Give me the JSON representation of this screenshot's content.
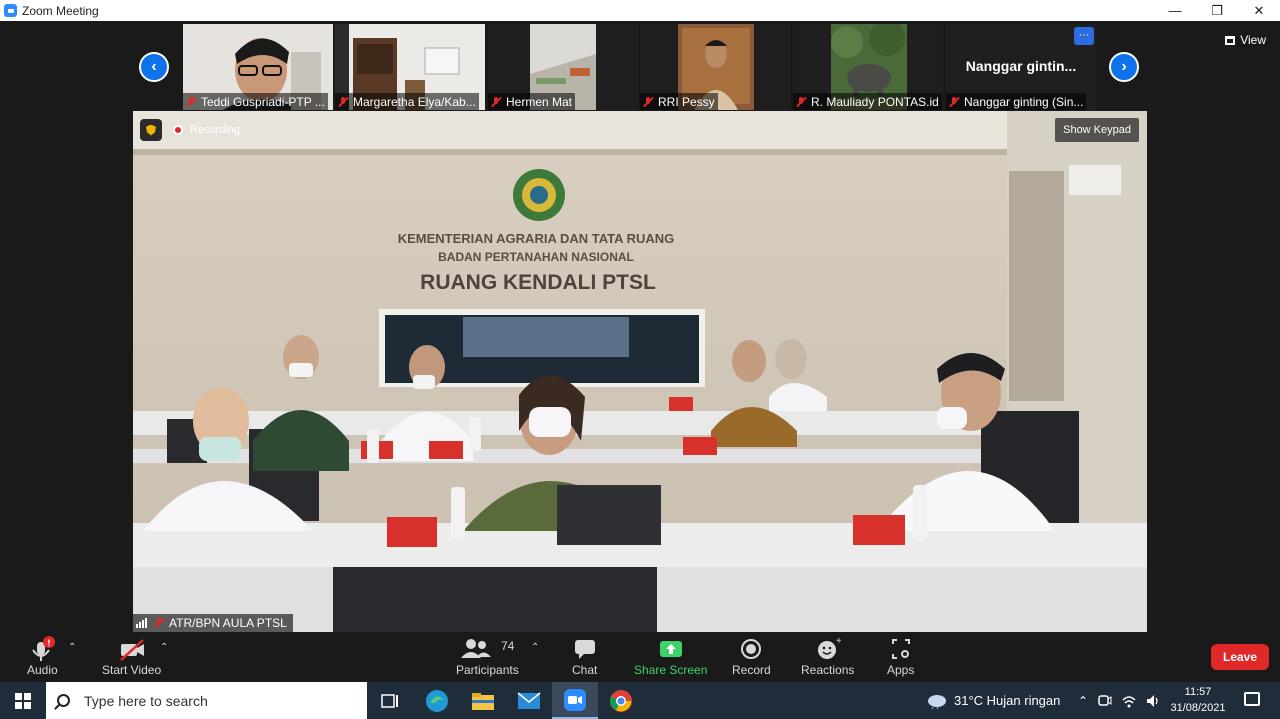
{
  "window": {
    "title": "Zoom Meeting",
    "minimize": "—",
    "restore": "❐",
    "close": "✕"
  },
  "gallery": {
    "prev_icon": "chevron-left-icon",
    "next_icon": "chevron-right-icon",
    "view_label": "View",
    "tiles": [
      {
        "name": "Teddi Guspriadi-PTP ...",
        "muted": true
      },
      {
        "name": "Margaretha Elya/Kab...",
        "muted": true
      },
      {
        "name": "Hermen Mat",
        "muted": true
      },
      {
        "name": "RRI Pessy",
        "muted": true
      },
      {
        "name": "R. Mauliady PONTAS.id",
        "muted": true
      },
      {
        "name": "Nanggar ginting (Sin...",
        "big_name": "Nanggar  gintin...",
        "more": "···",
        "muted": true
      }
    ]
  },
  "main_video": {
    "recording_label": "Recording",
    "show_keypad_label": "Show Keypad",
    "speaker_name": "ATR/BPN AULA PTSL",
    "wall_text": {
      "line1": "KEMENTERIAN AGRARIA DAN TATA RUANG",
      "line2": "BADAN PERTANAHAN NASIONAL",
      "line3": "RUANG KENDALI PTSL"
    }
  },
  "controls": {
    "audio": "Audio",
    "audio_badge": "!",
    "start_video": "Start Video",
    "participants": "Participants",
    "participants_count": "74",
    "chat": "Chat",
    "share_screen": "Share Screen",
    "record": "Record",
    "reactions": "Reactions",
    "apps": "Apps",
    "leave": "Leave"
  },
  "taskbar": {
    "search_placeholder": "Type here to search",
    "weather": "31°C  Hujan ringan",
    "time": "11:57",
    "date": "31/08/2021"
  }
}
